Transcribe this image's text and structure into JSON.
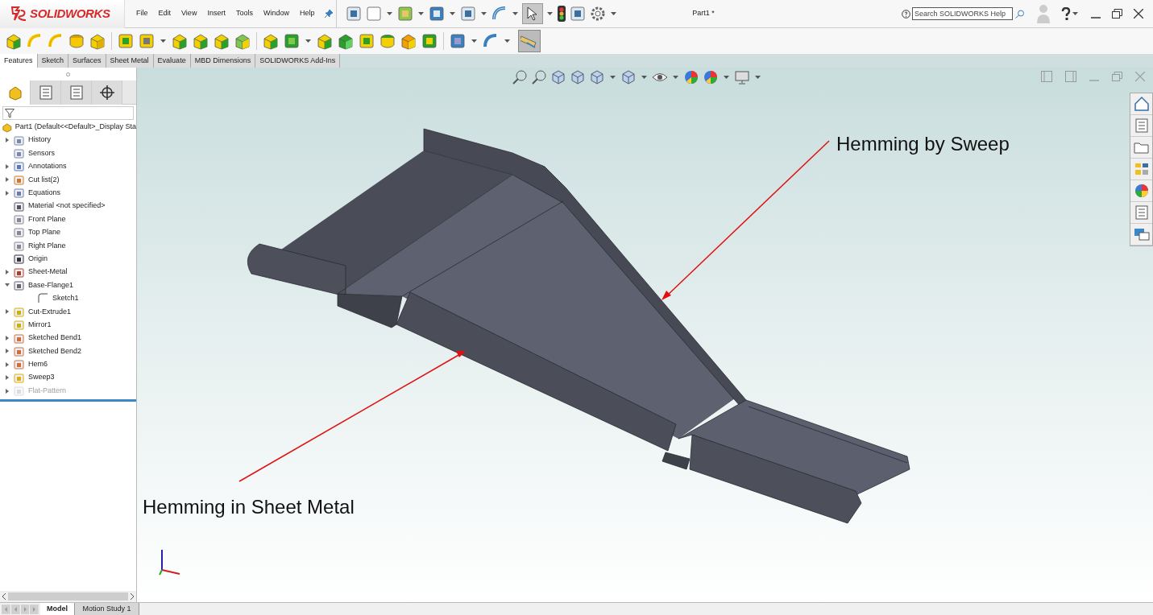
{
  "app": {
    "logo": "SOLIDWORKS"
  },
  "menu": [
    {
      "label": "File"
    },
    {
      "label": "Edit"
    },
    {
      "label": "View"
    },
    {
      "label": "Insert"
    },
    {
      "label": "Tools"
    },
    {
      "label": "Window"
    },
    {
      "label": "Help"
    }
  ],
  "document_title": "Part1 *",
  "help_search": {
    "placeholder": "Search SOLIDWORKS Help"
  },
  "command_tabs": [
    {
      "label": "Features",
      "selected": true
    },
    {
      "label": "Sketch",
      "selected": false
    },
    {
      "label": "Surfaces",
      "selected": false
    },
    {
      "label": "Sheet Metal",
      "selected": false
    },
    {
      "label": "Evaluate",
      "selected": false
    },
    {
      "label": "MBD Dimensions",
      "selected": false
    },
    {
      "label": "SOLIDWORKS Add-Ins",
      "selected": false
    }
  ],
  "panel_tabs": [
    {
      "selected": true
    },
    {
      "selected": false
    },
    {
      "selected": false
    },
    {
      "selected": false
    }
  ],
  "feature_tree": {
    "root": "Part1  (Default<<Default>_Display Sta",
    "items": [
      {
        "label": "History",
        "expanded": false,
        "disabled": false
      },
      {
        "label": "Sensors",
        "disabled": false
      },
      {
        "label": "Annotations",
        "expanded": false,
        "disabled": false
      },
      {
        "label": "Cut list(2)",
        "expanded": false,
        "disabled": false
      },
      {
        "label": "Equations",
        "expanded": false,
        "disabled": false
      },
      {
        "label": "Material <not specified>",
        "disabled": false
      },
      {
        "label": "Front Plane",
        "disabled": false
      },
      {
        "label": "Top Plane",
        "disabled": false
      },
      {
        "label": "Right Plane",
        "disabled": false
      },
      {
        "label": "Origin",
        "disabled": false
      },
      {
        "label": "Sheet-Metal",
        "expanded": false,
        "disabled": false
      },
      {
        "label": "Base-Flange1",
        "expanded": true,
        "disabled": false,
        "children": [
          {
            "label": "Sketch1",
            "disabled": false
          }
        ]
      },
      {
        "label": "Cut-Extrude1",
        "expanded": false,
        "disabled": false
      },
      {
        "label": "Mirror1",
        "disabled": false
      },
      {
        "label": "Sketched Bend1",
        "expanded": false,
        "disabled": false
      },
      {
        "label": "Sketched Bend2",
        "expanded": false,
        "disabled": false
      },
      {
        "label": "Hem6",
        "expanded": false,
        "disabled": false
      },
      {
        "label": "Sweep3",
        "expanded": false,
        "disabled": false
      },
      {
        "label": "Flat-Pattern",
        "expanded": false,
        "disabled": true
      }
    ]
  },
  "callouts": [
    {
      "text": "Hemming by Sweep"
    },
    {
      "text": "Hemming in Sheet Metal"
    }
  ],
  "bottom_tabs": [
    {
      "label": "Model",
      "selected": true
    },
    {
      "label": "Motion Study 1",
      "selected": false
    }
  ]
}
